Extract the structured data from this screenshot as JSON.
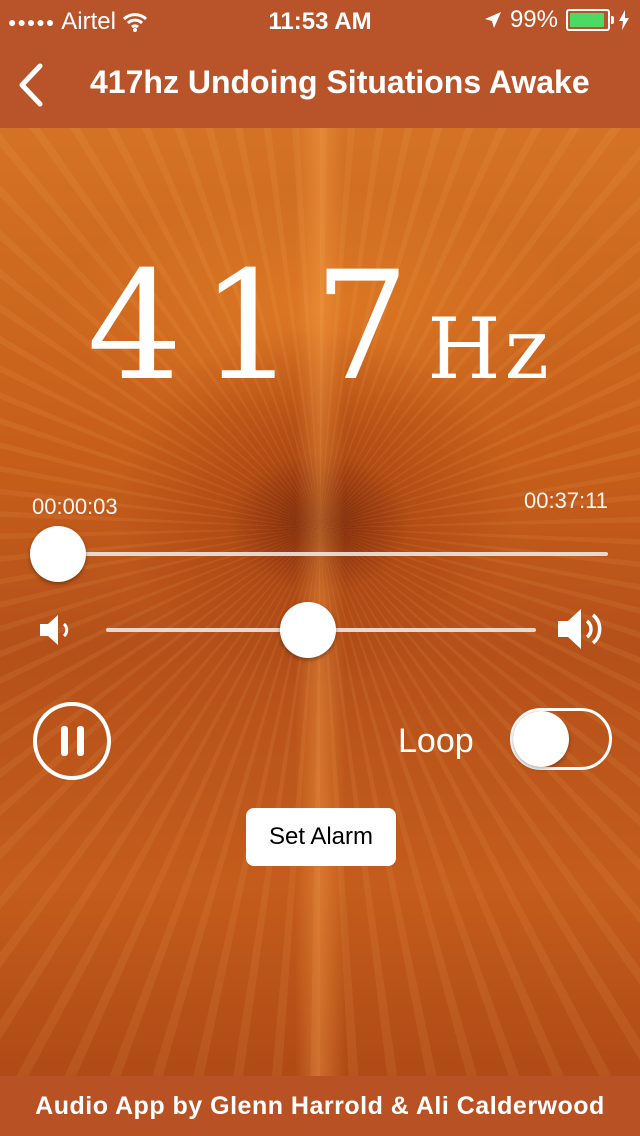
{
  "status_bar": {
    "carrier": "Airtel",
    "time": "11:53 AM",
    "battery": "99%"
  },
  "header": {
    "title": "417hz Undoing Situations Awake"
  },
  "hero": {
    "frequency": "417",
    "unit": "Hz"
  },
  "player": {
    "elapsed": "00:00:03",
    "duration": "00:37:11",
    "progress_fraction": 0.0,
    "volume_fraction": 0.47
  },
  "controls": {
    "loop_label": "Loop",
    "loop_on": false,
    "set_alarm_label": "Set Alarm"
  },
  "footer": {
    "text": "Audio App by Glenn Harrold & Ali Calderwood"
  },
  "colors": {
    "header_bg": "#b9532a",
    "footer_bg": "#b85224",
    "battery_fill": "#4cd964"
  }
}
